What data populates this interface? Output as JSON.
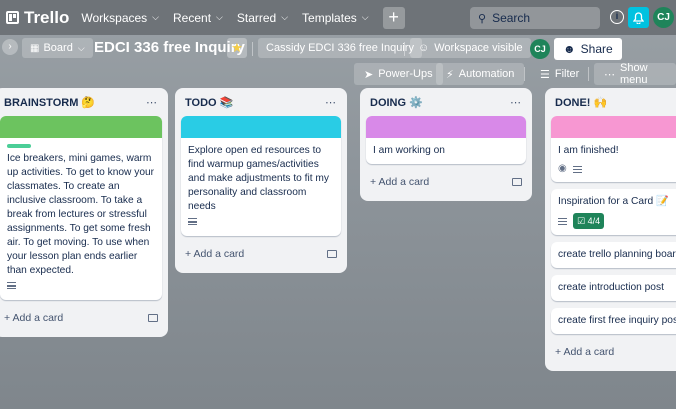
{
  "nav": {
    "logo": "Trello",
    "items": [
      "Workspaces",
      "Recent",
      "Starred",
      "Templates"
    ],
    "search_placeholder": "Search",
    "avatar": "CJ"
  },
  "board": {
    "switcher": "Board",
    "title": "EDCI 336 free Inquiry",
    "workspace": "Cassidy EDCI 336 free Inquiry",
    "visibility": "Workspace visible",
    "member": "CJ",
    "share": "Share",
    "powerups": "Power-Ups",
    "automation": "Automation",
    "filter": "Filter",
    "show_menu": "Show menu"
  },
  "lists": [
    {
      "title": "BRAINSTORM 🤔",
      "cover_color": "#6cc35f",
      "card_text": "Ice breakers, mini games, warm up activities. To get to know your classmates. To create an inclusive classroom. To take a break from lectures or stressful assignments. To get some fresh air. To get moving. To use when your lesson plan ends earlier than expected.",
      "add": "+ Add a card"
    },
    {
      "title": "TODO 📚",
      "cover_color": "#29cce5",
      "card_text": "Explore open ed resources to find warmup games/activities and make adjustments to fit my personality and classroom needs",
      "add": "+ Add a card"
    },
    {
      "title": "DOING ⚙️",
      "cover_color": "#d889e8",
      "card_text": "I am working on",
      "add": "+ Add a card"
    },
    {
      "title": "DONE! 🙌",
      "cover_color": "#f797d2",
      "cards": [
        "I am finished!",
        "Inspiration for a Card 📝",
        "create trello planning board",
        "create introduction post",
        "create first free inquiry post"
      ],
      "checklist": "4/4",
      "add": "+ Add a card"
    }
  ]
}
